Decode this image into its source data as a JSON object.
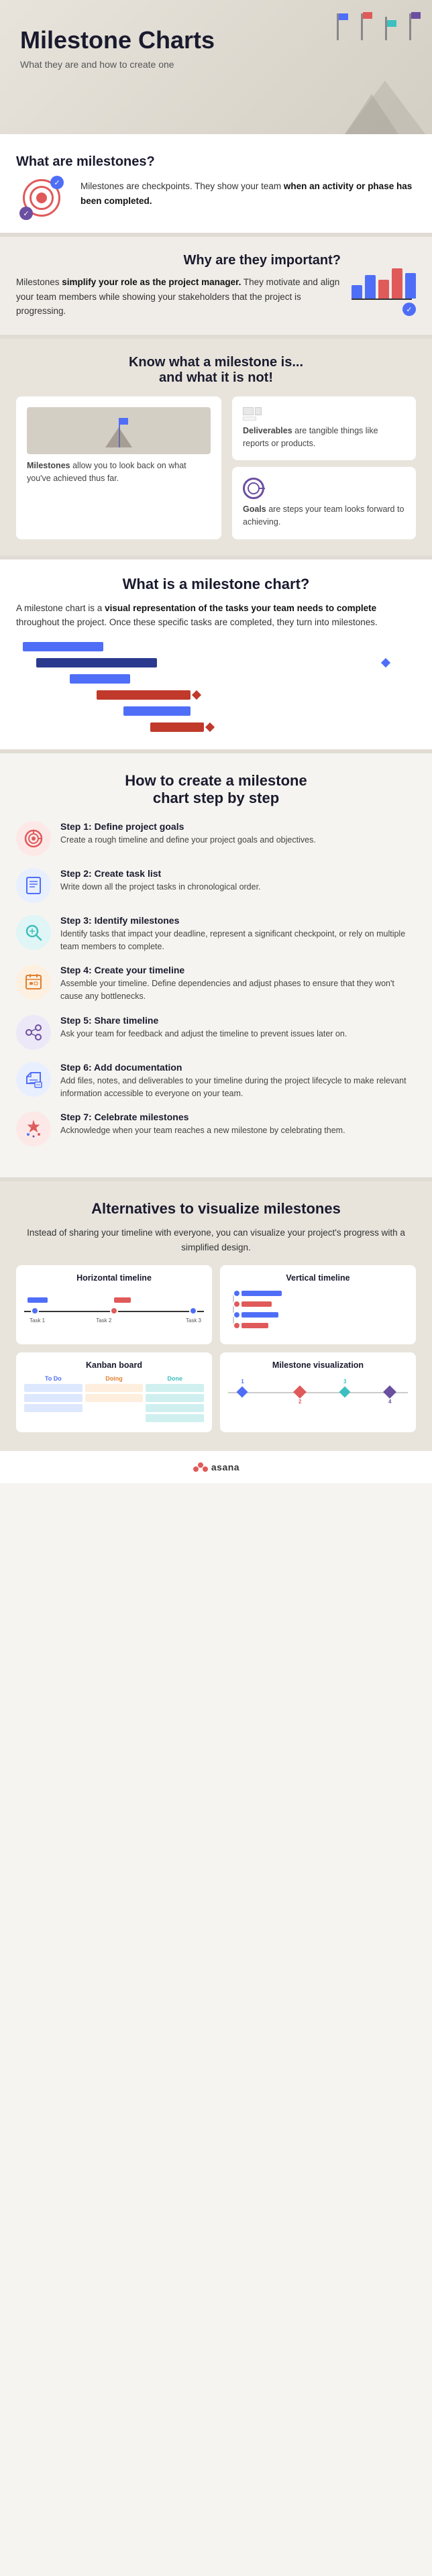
{
  "hero": {
    "title": "Milestone Charts",
    "subtitle": "What they are and how to create one"
  },
  "what_are": {
    "title": "What are milestones?",
    "body": "Milestones are checkpoints. They show your team ",
    "bold": "when an activity or phase has been completed.",
    "body2": ""
  },
  "why_important": {
    "title": "Why are they important?",
    "body": "Milestones ",
    "bold": "simplify your role as the project manager.",
    "body2": " They motivate and align your team members while showing your stakeholders that the project is progressing."
  },
  "know": {
    "title_line1": "Know what a milestone is...",
    "title_line2": "and what it is not!",
    "milestones_card": {
      "title": "Milestones",
      "text": "allow you to look back on what you've achieved thus far."
    },
    "deliverables_card": {
      "title": "Deliverables",
      "text": "are tangible things like reports or products."
    },
    "goals_card": {
      "title": "Goals",
      "text": "are steps your team looks forward to achieving."
    }
  },
  "what_is_chart": {
    "title": "What is a milestone chart?",
    "body": "A milestone chart is a ",
    "bold": "visual representation of the tasks your team needs to complete",
    "body2": " throughout the project. Once these specific tasks are completed, they turn into milestones."
  },
  "howto": {
    "title_line1": "How to create a milestone",
    "title_line2": "chart step by step",
    "steps": [
      {
        "id": "step1",
        "title": "Step 1: Define project goals",
        "desc": "Create a rough timeline and define your project goals and objectives.",
        "icon_emoji": "🎯",
        "icon_bg": "ic-pink"
      },
      {
        "id": "step2",
        "title": "Step 2: Create task list",
        "desc": "Write down all the project tasks in chronological order.",
        "icon_emoji": "📋",
        "icon_bg": "ic-blue"
      },
      {
        "id": "step3",
        "title": "Step 3: Identify milestones",
        "desc": "Identify tasks that impact your deadline, represent a significant checkpoint, or rely on multiple team members to complete.",
        "icon_emoji": "🔍",
        "icon_bg": "ic-teal"
      },
      {
        "id": "step4",
        "title": "Step 4: Create your timeline",
        "desc": "Assemble your timeline. Define dependencies and adjust phases to ensure that they won't cause any bottlenecks.",
        "icon_emoji": "📅",
        "icon_bg": "ic-orange"
      },
      {
        "id": "step5",
        "title": "Step 5: Share timeline",
        "desc": "Ask your team for feedback and adjust the timeline to prevent issues later on.",
        "icon_emoji": "🔗",
        "icon_bg": "ic-purple"
      },
      {
        "id": "step6",
        "title": "Step 6: Add documentation",
        "desc": "Add files, notes, and deliverables to your timeline during the project lifecycle to make relevant information accessible to everyone on your team.",
        "icon_emoji": "📁",
        "icon_bg": "ic-blue"
      },
      {
        "id": "step7",
        "title": "Step 7: Celebrate milestones",
        "desc": "Acknowledge when your team reaches a new milestone by celebrating them.",
        "icon_emoji": "🎉",
        "icon_bg": "ic-red"
      }
    ]
  },
  "alternatives": {
    "title": "Alternatives to visualize milestones",
    "body": "Instead of sharing your timeline with everyone, you can visualize your project's progress with a simplified design.",
    "options": [
      {
        "title": "Horizontal timeline",
        "type": "horizontal"
      },
      {
        "title": "Vertical timeline",
        "type": "vertical"
      },
      {
        "title": "Kanban board",
        "type": "kanban"
      },
      {
        "title": "Milestone visualization",
        "type": "mviz"
      }
    ]
  },
  "footer": {
    "brand": "asana"
  }
}
